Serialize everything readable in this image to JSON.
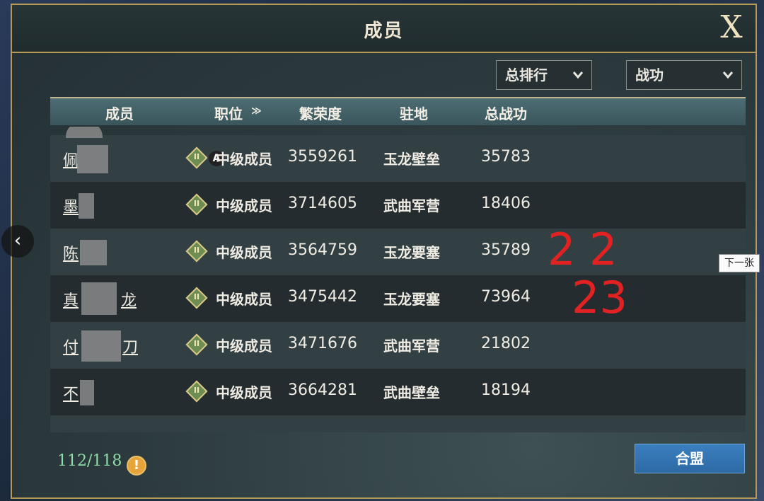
{
  "window": {
    "title": "成员",
    "close_label": "X"
  },
  "filters": {
    "ranking": "总排行",
    "sort": "战功",
    "chevron": "⌄"
  },
  "table": {
    "headers": {
      "member": "成员",
      "role": "职位",
      "role_sort_icon": "≫",
      "prosperity": "繁荣度",
      "base": "驻地",
      "merit": "总战功"
    },
    "rows": [
      {
        "name": "佩",
        "rank_icon": "II",
        "role": "中级成员",
        "prosperity": "3559261",
        "base": "玉龙壁垒",
        "merit": "35783",
        "badge": "A"
      },
      {
        "name": "墨",
        "rank_icon": "II",
        "role": "中级成员",
        "prosperity": "3714605",
        "base": "武曲军营",
        "merit": "18406"
      },
      {
        "name": "陈",
        "rank_icon": "II",
        "role": "中级成员",
        "prosperity": "3564759",
        "base": "玉龙要塞",
        "merit": "35789"
      },
      {
        "name": "真",
        "name_suffix": "龙",
        "rank_icon": "II",
        "role": "中级成员",
        "prosperity": "3475442",
        "base": "玉龙要塞",
        "merit": "73964"
      },
      {
        "name": "付",
        "name_suffix": "刀",
        "rank_icon": "II",
        "role": "中级成员",
        "prosperity": "3471676",
        "base": "武曲军营",
        "merit": "21802"
      },
      {
        "name": "不",
        "rank_icon": "II",
        "role": "中级成员",
        "prosperity": "3664281",
        "base": "武曲壁垒",
        "merit": "18194"
      }
    ]
  },
  "footer": {
    "member_count": "112/118",
    "warning_icon": "!",
    "join_button": "合盟"
  },
  "viewer": {
    "prev_arrow": "‹",
    "next_tooltip": "下一张"
  },
  "annotations": {
    "mark_1": "2 2",
    "mark_2": "23",
    "color": "#e22222"
  }
}
